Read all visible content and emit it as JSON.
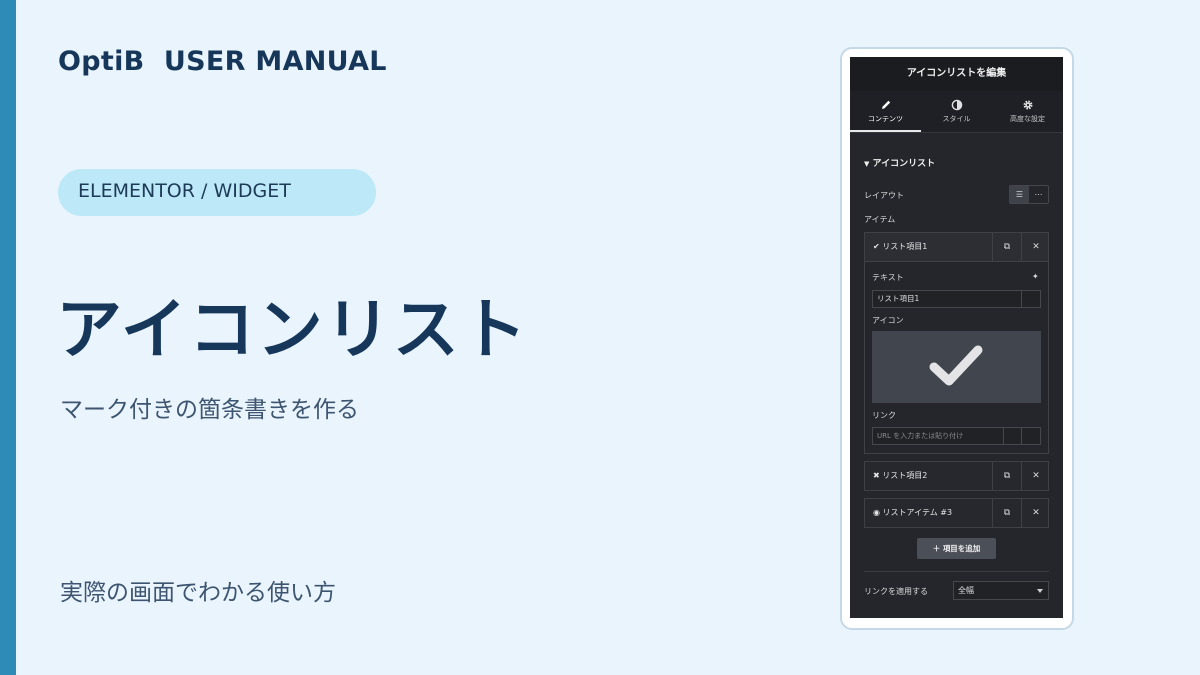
{
  "brand": "OptiB  USER MANUAL",
  "category": "ELEMENTOR / WIDGET",
  "title": "アイコンリスト",
  "subtitle": "マーク付きの箇条書きを作る",
  "footer_note": "実際の画面でわかる使い方",
  "colors": {
    "accent": "#2e8bb8",
    "background": "#eaf4fc",
    "pill": "#bde8f8",
    "title": "#16375a",
    "panel": "#24262b"
  },
  "panel": {
    "header": "アイコンリストを編集",
    "tabs": [
      {
        "label": "コンテンツ",
        "icon": "pencil-icon"
      },
      {
        "label": "スタイル",
        "icon": "contrast-icon"
      },
      {
        "label": "高度な設定",
        "icon": "gear-icon"
      }
    ],
    "section": "アイコンリスト",
    "layout_label": "レイアウト",
    "items_label": "アイテム",
    "items": [
      {
        "label": "リスト項目1",
        "icon": "check-icon"
      },
      {
        "label": "リスト項目2",
        "icon": "times-icon"
      },
      {
        "label": "リストアイテム #3",
        "icon": "dot-circle-icon"
      }
    ],
    "text_label": "テキスト",
    "text_value": "リスト項目1",
    "icon_label": "アイコン",
    "link_label": "リンク",
    "url_placeholder": "URL を入力または貼り付け",
    "add_button": "項目を追加",
    "apply_link_label": "リンクを適用する",
    "apply_link_value": "全幅"
  }
}
